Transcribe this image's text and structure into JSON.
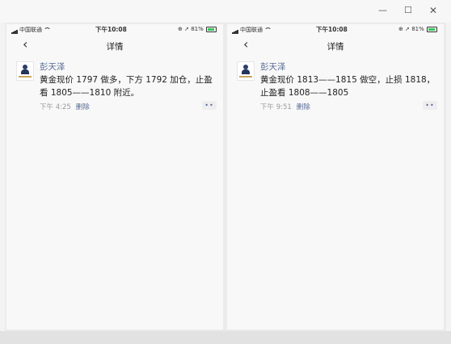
{
  "window": {
    "minimize_glyph": "—",
    "maximize_glyph": "☐",
    "close_glyph": "✕"
  },
  "panels": [
    {
      "status": {
        "carrier": "中国联通",
        "time": "下午10:08",
        "battery": "81%"
      },
      "nav": {
        "title": "详情"
      },
      "post": {
        "author": "彭天泽",
        "content": "黄金现价 1797 做多，下方 1792 加仓，止盈看 1805——1810 附近。",
        "time": "下午 4:25",
        "delete_label": "删除"
      }
    },
    {
      "status": {
        "carrier": "中国联通",
        "time": "下午10:08",
        "battery": "81%"
      },
      "nav": {
        "title": "详情"
      },
      "post": {
        "author": "彭天泽",
        "content": "黄金现价 1813——1815 做空，止损 1818，止盈看 1808——1805",
        "time": "下午 9:51",
        "delete_label": "删除"
      }
    }
  ],
  "icons": {
    "back": "chevron-left-icon",
    "more": "more-dots-icon",
    "battery_color": "#35c659",
    "link_color": "#576b95"
  }
}
